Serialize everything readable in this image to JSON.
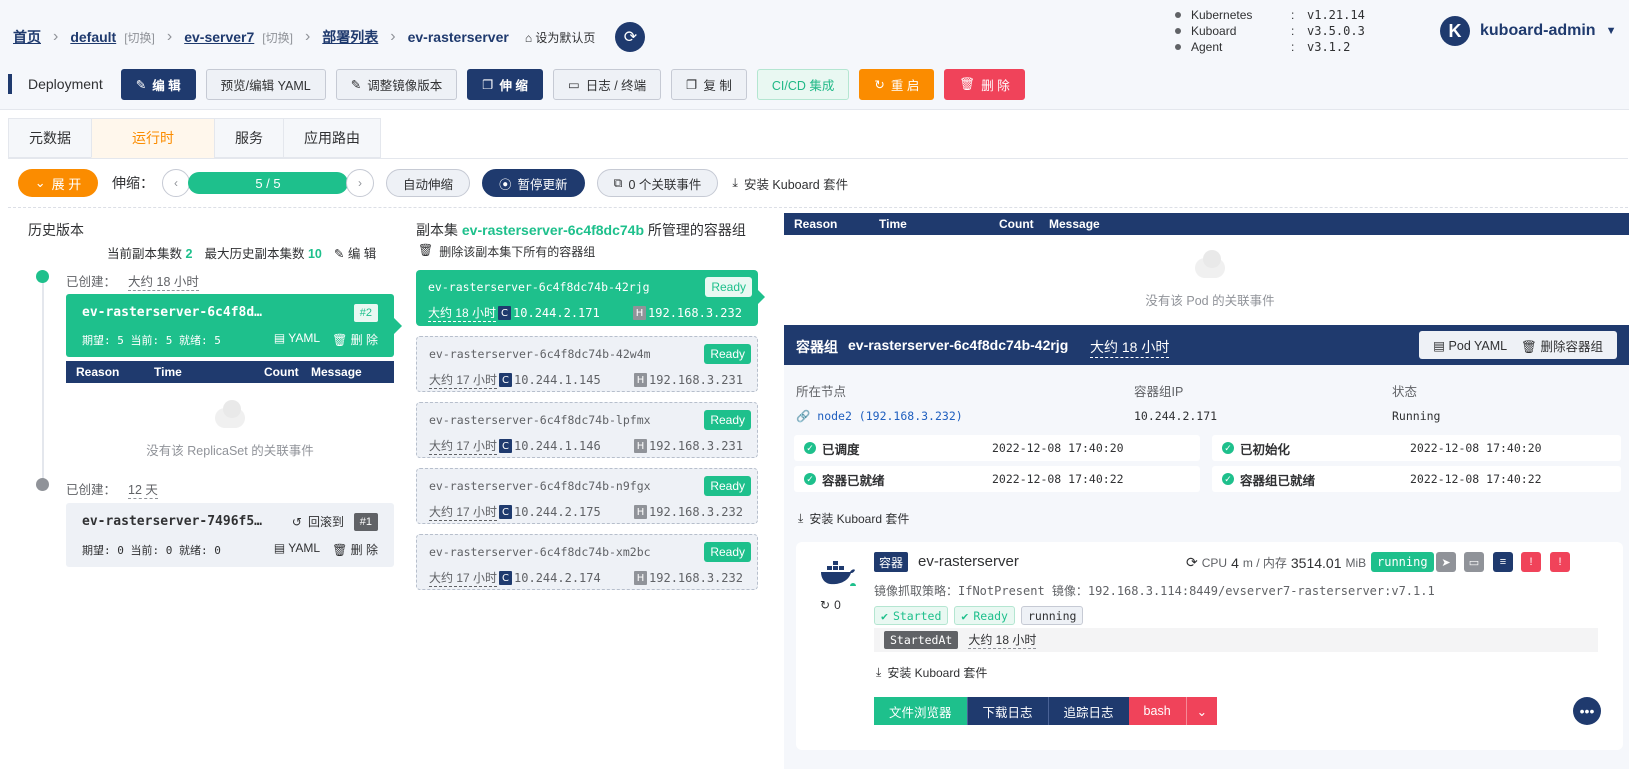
{
  "breadcrumb": {
    "home": "首页",
    "namespace": "default",
    "switch1": "[切换]",
    "cluster": "ev-server7",
    "switch2": "[切换]",
    "list": "部署列表",
    "current": "ev-rasterserver",
    "set_default": "设为默认页"
  },
  "versions": [
    {
      "key": "Kubernetes",
      "sep": ":",
      "value": "v1.21.14"
    },
    {
      "key": "Kuboard",
      "sep": ":",
      "value": "v3.5.0.3"
    },
    {
      "key": "Agent",
      "sep": ":",
      "value": "v3.1.2"
    }
  ],
  "user": {
    "avatar": "K",
    "name": "kuboard-admin"
  },
  "toolbar": {
    "kind": "Deployment",
    "edit": "编 辑",
    "yaml": "预览/编辑 YAML",
    "image": "调整镜像版本",
    "scale": "伸 缩",
    "logs": "日志 / 终端",
    "copy": "复 制",
    "cicd": "CI/CD 集成",
    "restart": "重 启",
    "delete": "删 除"
  },
  "tabs": [
    "元数据",
    "运行时",
    "服务",
    "应用路由"
  ],
  "controls": {
    "expand": "展 开",
    "scale_label": "伸缩：",
    "replicas": "5 / 5",
    "autoscale": "自动伸缩",
    "pause": "暂停更新",
    "events": "0 个关联事件",
    "install": "安装 Kuboard 套件"
  },
  "history": {
    "title": "历史版本",
    "current_label": "当前副本集数",
    "current_value": "2",
    "max_label": "最大历史副本集数",
    "max_value": "10",
    "edit": "编 辑",
    "created_label": "已创建：",
    "rs1": {
      "created": "大约 18 小时",
      "name": "ev-rasterserver-6c4f8d…",
      "tag": "#2",
      "stats": "期望: 5  当前: 5  就绪: 5",
      "yaml": "YAML",
      "delete": "删 除"
    },
    "rs2": {
      "created": "12 天",
      "name": "ev-rasterserver-7496f5…",
      "rollback": "回滚到",
      "tag": "#1",
      "stats": "期望: 0  当前: 0  就绪: 0",
      "yaml": "YAML",
      "delete": "删 除"
    },
    "empty_events": "没有该 ReplicaSet 的关联事件"
  },
  "event_columns": [
    "Reason",
    "Time",
    "Count",
    "Message"
  ],
  "replicaset": {
    "title_pre": "副本集",
    "name": "ev-rasterserver-6c4f8dc74b",
    "title_post": "所管理的容器组",
    "delete_all": "删除该副本集下所有的容器组",
    "pods": [
      {
        "name": "ev-rasterserver-6c4f8dc74b-42rjg",
        "status": "Ready",
        "age": "大约 18 小时",
        "ip": "10.244.2.171",
        "host": "192.168.3.232"
      },
      {
        "name": "ev-rasterserver-6c4f8dc74b-42w4m",
        "status": "Ready",
        "age": "大约 17 小时",
        "ip": "10.244.1.145",
        "host": "192.168.3.231"
      },
      {
        "name": "ev-rasterserver-6c4f8dc74b-lpfmx",
        "status": "Ready",
        "age": "大约 17 小时",
        "ip": "10.244.1.146",
        "host": "192.168.3.231"
      },
      {
        "name": "ev-rasterserver-6c4f8dc74b-n9fgx",
        "status": "Ready",
        "age": "大约 17 小时",
        "ip": "10.244.2.175",
        "host": "192.168.3.232"
      },
      {
        "name": "ev-rasterserver-6c4f8dc74b-xm2bc",
        "status": "Ready",
        "age": "大约 17 小时",
        "ip": "10.244.2.174",
        "host": "192.168.3.232"
      }
    ]
  },
  "pod_events_empty": "没有该 Pod 的关联事件",
  "pod_detail": {
    "title": "容器组",
    "name": "ev-rasterserver-6c4f8dc74b-42rjg",
    "age": "大约 18 小时",
    "pod_yaml": "Pod YAML",
    "delete_pod": "删除容器组",
    "node_label": "所在节点",
    "node_value": "node2  (192.168.3.232)",
    "ip_label": "容器组IP",
    "ip_value": "10.244.2.171",
    "status_label": "状态",
    "status_value": "Running",
    "conditions": [
      {
        "name": "已调度",
        "time": "2022-12-08 17:40:20"
      },
      {
        "name": "已初始化",
        "time": "2022-12-08 17:40:20"
      },
      {
        "name": "容器已就绪",
        "time": "2022-12-08 17:40:22"
      },
      {
        "name": "容器组已就绪",
        "time": "2022-12-08 17:40:22"
      }
    ],
    "install": "安装 Kuboard 套件"
  },
  "container": {
    "tag": "容器",
    "name": "ev-rasterserver",
    "restarts": "0",
    "cpu_label": "CPU",
    "cpu_value": "4",
    "cpu_unit": "m / 内存",
    "mem_value": "3514.01",
    "mem_unit": "MiB",
    "state": "running",
    "image_line": "镜像抓取策略：IfNotPresent    镜像：192.168.3.114:8449/evserver7-rasterserver:v7.1.1",
    "tags": [
      "Started",
      "Ready",
      "running"
    ],
    "started_label": "StartedAt",
    "started_value": "大约 18 小时",
    "install": "安装 Kuboard 套件",
    "buttons": {
      "files": "文件浏览器",
      "download": "下载日志",
      "follow": "追踪日志",
      "bash": "bash"
    }
  },
  "colors": {
    "primary": "#1f3a6e",
    "green": "#1ec08c",
    "orange": "#fb8c00",
    "red": "#f0435a"
  }
}
